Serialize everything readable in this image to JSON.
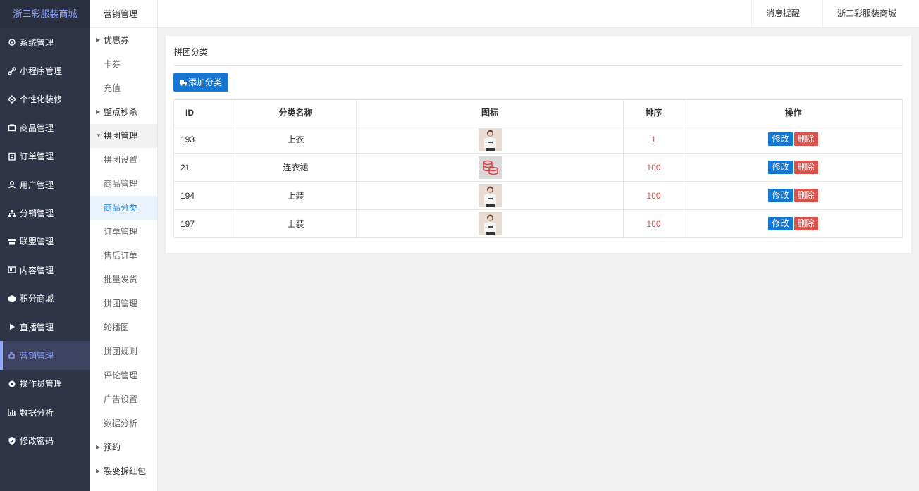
{
  "brand": "浙三彩服装商城",
  "nav": [
    {
      "label": "系统管理",
      "icon": "gear-icon"
    },
    {
      "label": "小程序管理",
      "icon": "link-icon"
    },
    {
      "label": "个性化装修",
      "icon": "palette-icon"
    },
    {
      "label": "商品管理",
      "icon": "bag-icon"
    },
    {
      "label": "订单管理",
      "icon": "clipboard-icon"
    },
    {
      "label": "用户管理",
      "icon": "user-icon"
    },
    {
      "label": "分销管理",
      "icon": "sitemap-icon"
    },
    {
      "label": "联盟管理",
      "icon": "store-icon"
    },
    {
      "label": "内容管理",
      "icon": "card-icon"
    },
    {
      "label": "积分商城",
      "icon": "cube-icon"
    },
    {
      "label": "直播管理",
      "icon": "play-icon"
    },
    {
      "label": "营销管理",
      "icon": "hand-icon"
    },
    {
      "label": "操作员管理",
      "icon": "cog-icon"
    },
    {
      "label": "数据分析",
      "icon": "bar-chart-icon"
    },
    {
      "label": "修改密码",
      "icon": "shield-icon"
    }
  ],
  "sub_sidebar": {
    "title": "营销管理",
    "groups_top": [
      "优惠券",
      "卡券",
      "充值",
      "整点秒杀"
    ],
    "open_group": "拼团管理",
    "items": [
      "拼团设置",
      "商品管理",
      "商品分类",
      "订单管理",
      "售后订单",
      "批量发货",
      "拼团管理",
      "轮播图",
      "拼团规则",
      "评论管理",
      "广告设置",
      "数据分析"
    ],
    "groups_bottom": [
      "预约",
      "裂变拆红包"
    ]
  },
  "topbar": {
    "messages": "消息提醒",
    "store": "浙三彩服装商城"
  },
  "panel": {
    "title": "拼团分类",
    "add_button": "添加分类"
  },
  "table": {
    "headers": [
      "ID",
      "分类名称",
      "图标",
      "排序",
      "操作"
    ],
    "rows": [
      {
        "id": "193",
        "name": "上衣",
        "icon": "clothing-photo",
        "sort": "1"
      },
      {
        "id": "21",
        "name": "连衣裙",
        "icon": "coins-icon",
        "sort": "100"
      },
      {
        "id": "194",
        "name": "上装",
        "icon": "clothing-photo",
        "sort": "100"
      },
      {
        "id": "197",
        "name": "上装",
        "icon": "clothing-photo",
        "sort": "100"
      }
    ],
    "edit_label": "修改",
    "delete_label": "删除"
  },
  "colors": {
    "sidebar_bg": "#2f3447",
    "accent": "#8fa6ff",
    "primary": "#1677d2",
    "danger": "#d9534f"
  }
}
